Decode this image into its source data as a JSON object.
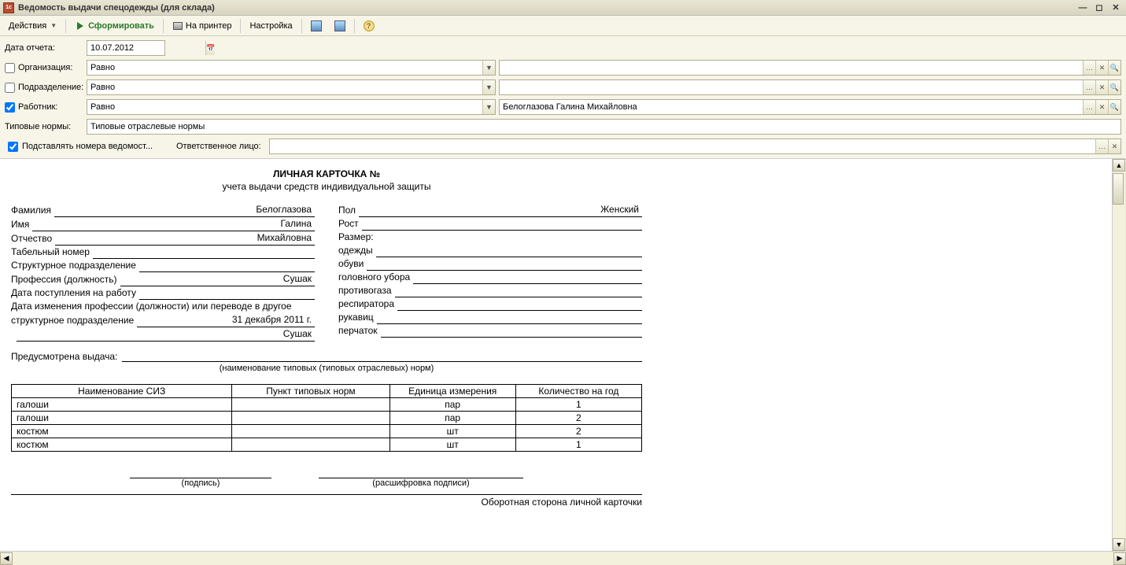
{
  "window": {
    "title": "Ведомость выдачи спецодежды (для склада)"
  },
  "toolbar": {
    "actions": "Действия",
    "generate": "Сформировать",
    "print": "На принтер",
    "settings": "Настройка"
  },
  "filters": {
    "report_date_label": "Дата отчета:",
    "report_date_value": "10.07.2012",
    "org_label": "Организация:",
    "org_op": "Равно",
    "org_value": "",
    "dept_label": "Подразделение:",
    "dept_op": "Равно",
    "dept_value": "",
    "emp_label": "Работник:",
    "emp_op": "Равно",
    "emp_value": "Белоглазова Галина Михайловна",
    "norms_label": "Типовые нормы:",
    "norms_value": "Типовые отраслевые нормы",
    "subst_label": "Подставлять номера ведомост...",
    "resp_label": "Ответственное лицо:",
    "resp_value": ""
  },
  "card": {
    "title": "ЛИЧНАЯ КАРТОЧКА №",
    "subtitle": "учета выдачи средств индивидуальной защиты",
    "left": {
      "surname_label": "Фамилия",
      "surname": "Белоглазова",
      "name_label": "Имя",
      "name": "Галина",
      "patronymic_label": "Отчество",
      "patronymic": "Михайловна",
      "tabno_label": "Табельный номер",
      "tabno": "",
      "struct_label": "Структурное подразделение",
      "struct": "",
      "profession_label": "Профессия (должность)",
      "profession": "Сушак",
      "hiredate_label": "Дата поступления на работу",
      "hiredate": "",
      "changedate_label": "Дата изменения профессии (должности) или переводе в другое",
      "changedate_label2": "структурное подразделение",
      "changedate": "31 декабря 2011 г.",
      "changedate_extra": "Сушак"
    },
    "right": {
      "sex_label": "Пол",
      "sex": "Женский",
      "height_label": "Рост",
      "height": "",
      "size_label": "Размер:",
      "clothes_label": "одежды",
      "clothes": "",
      "shoes_label": "обуви",
      "shoes": "",
      "head_label": "головного убора",
      "head": "",
      "gasmask_label": "противогаза",
      "gasmask": "",
      "respirator_label": "респиратора",
      "respirator": "",
      "gloves_label": "рукавиц",
      "gloves": "",
      "handgloves_label": "перчаток",
      "handgloves": ""
    },
    "issue_label": "Предусмотрена выдача:",
    "issue_value": "",
    "issue_caption": "(наименование типовых (типовых отраслевых) норм)",
    "table": {
      "h1": "Наименование СИЗ",
      "h2": "Пункт типовых норм",
      "h3": "Единица измерения",
      "h4": "Количество на год",
      "rows": [
        {
          "name": "галоши",
          "punkt": "",
          "unit": "пар",
          "qty": "1"
        },
        {
          "name": "галоши",
          "punkt": "",
          "unit": "пар",
          "qty": "2"
        },
        {
          "name": "костюм",
          "punkt": "",
          "unit": "шт",
          "qty": "2"
        },
        {
          "name": "костюм",
          "punkt": "",
          "unit": "шт",
          "qty": "1"
        }
      ]
    },
    "sign_signature": "(подпись)",
    "sign_decipher": "(расшифровка подписи)",
    "back_side": "Оборотная сторона личной карточки"
  }
}
